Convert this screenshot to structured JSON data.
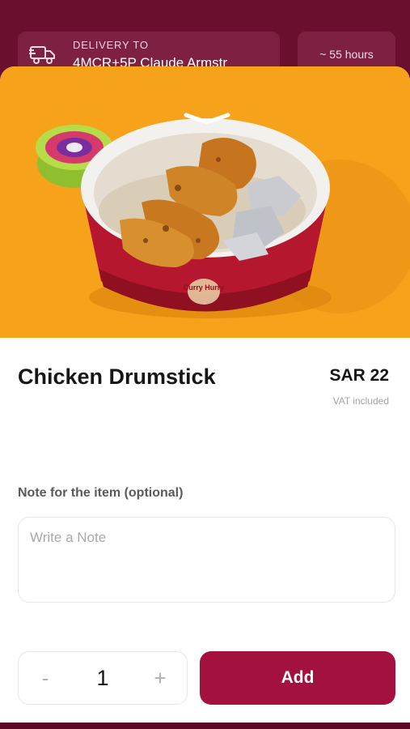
{
  "header": {
    "delivery_label": "DELIVERY TO",
    "delivery_address": "4MCR+5P Claude Armstr",
    "eta": "~ 55 hours"
  },
  "item": {
    "image_brand_text": "Curry Hurry",
    "title": "Chicken Drumstick",
    "price": "SAR 22",
    "vat_note": "VAT included"
  },
  "note": {
    "label": "Note for the item (optional)",
    "placeholder": "Write a Note",
    "value": ""
  },
  "quantity": {
    "minus_label": "-",
    "value": "1",
    "plus_label": "+"
  },
  "actions": {
    "add_label": "Add"
  },
  "colors": {
    "brand": "#a3113f",
    "header_bg": "#6a0f2e",
    "image_bg": "#f7a21b"
  }
}
